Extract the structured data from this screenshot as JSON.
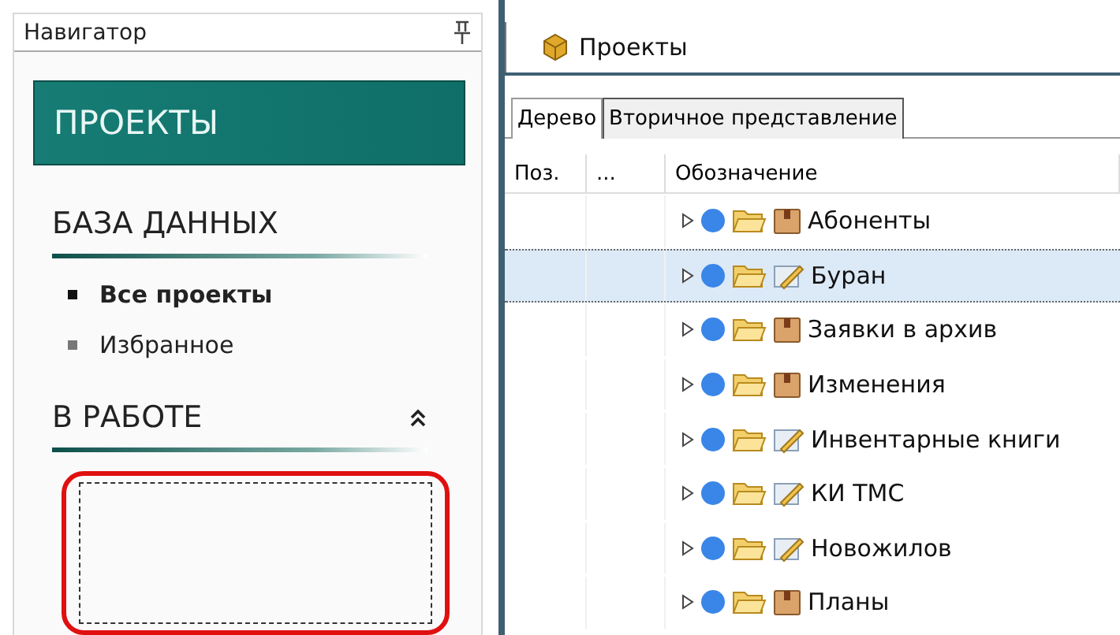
{
  "navigator": {
    "title": "Навигатор",
    "banner": "ПРОЕКТЫ",
    "sections": [
      {
        "title": "БАЗА ДАННЫХ",
        "kind": "list",
        "items": [
          {
            "label": "Все проекты",
            "selected": true
          },
          {
            "label": "Избранное",
            "selected": false
          }
        ]
      },
      {
        "title": "В РАБОТЕ",
        "kind": "dropzone"
      }
    ]
  },
  "document_tab": {
    "label": "Проекты"
  },
  "tabs": [
    {
      "label": "Дерево",
      "selected": true
    },
    {
      "label": "Вторичное представление",
      "selected": false
    }
  ],
  "table": {
    "columns": [
      "Поз.",
      "...",
      "Обозначение"
    ],
    "rows": [
      {
        "name": "Абоненты",
        "kind": "package",
        "selected": false
      },
      {
        "name": "Буран",
        "kind": "document",
        "selected": true
      },
      {
        "name": "Заявки в архив",
        "kind": "package",
        "selected": false
      },
      {
        "name": "Изменения",
        "kind": "package",
        "selected": false
      },
      {
        "name": "Инвентарные книги",
        "kind": "document",
        "selected": false
      },
      {
        "name": "КИ ТМС",
        "kind": "document",
        "selected": false
      },
      {
        "name": "Новожилов",
        "kind": "document",
        "selected": false
      },
      {
        "name": "Планы",
        "kind": "package",
        "selected": false
      }
    ]
  }
}
